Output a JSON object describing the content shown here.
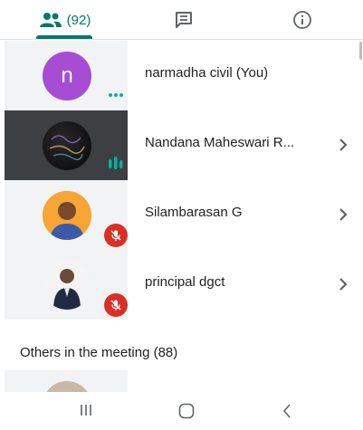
{
  "tabs": {
    "people_count": "(92)",
    "active": "people",
    "accent_color": "#00796b",
    "icons": [
      "people-icon",
      "chat-icon",
      "info-icon"
    ]
  },
  "participants": [
    {
      "name": "narmadha civil (You)",
      "avatar_letter": "n",
      "avatar_color": "#a64dd3",
      "status": "more-options-dots"
    },
    {
      "name": "Nandana Maheswari R...",
      "avatar": "dark-photo",
      "status": "speaking-bars",
      "has_chevron": true
    },
    {
      "name": "Silambarasan G",
      "avatar": "photo",
      "status": "muted",
      "has_chevron": true
    },
    {
      "name": "principal dgct",
      "avatar": "photo",
      "status": "muted",
      "has_chevron": true
    }
  ],
  "others_section": {
    "title": "Others in the meeting (88)"
  },
  "system_nav": {
    "icons": [
      "recents-icon",
      "home-icon",
      "back-icon"
    ]
  }
}
